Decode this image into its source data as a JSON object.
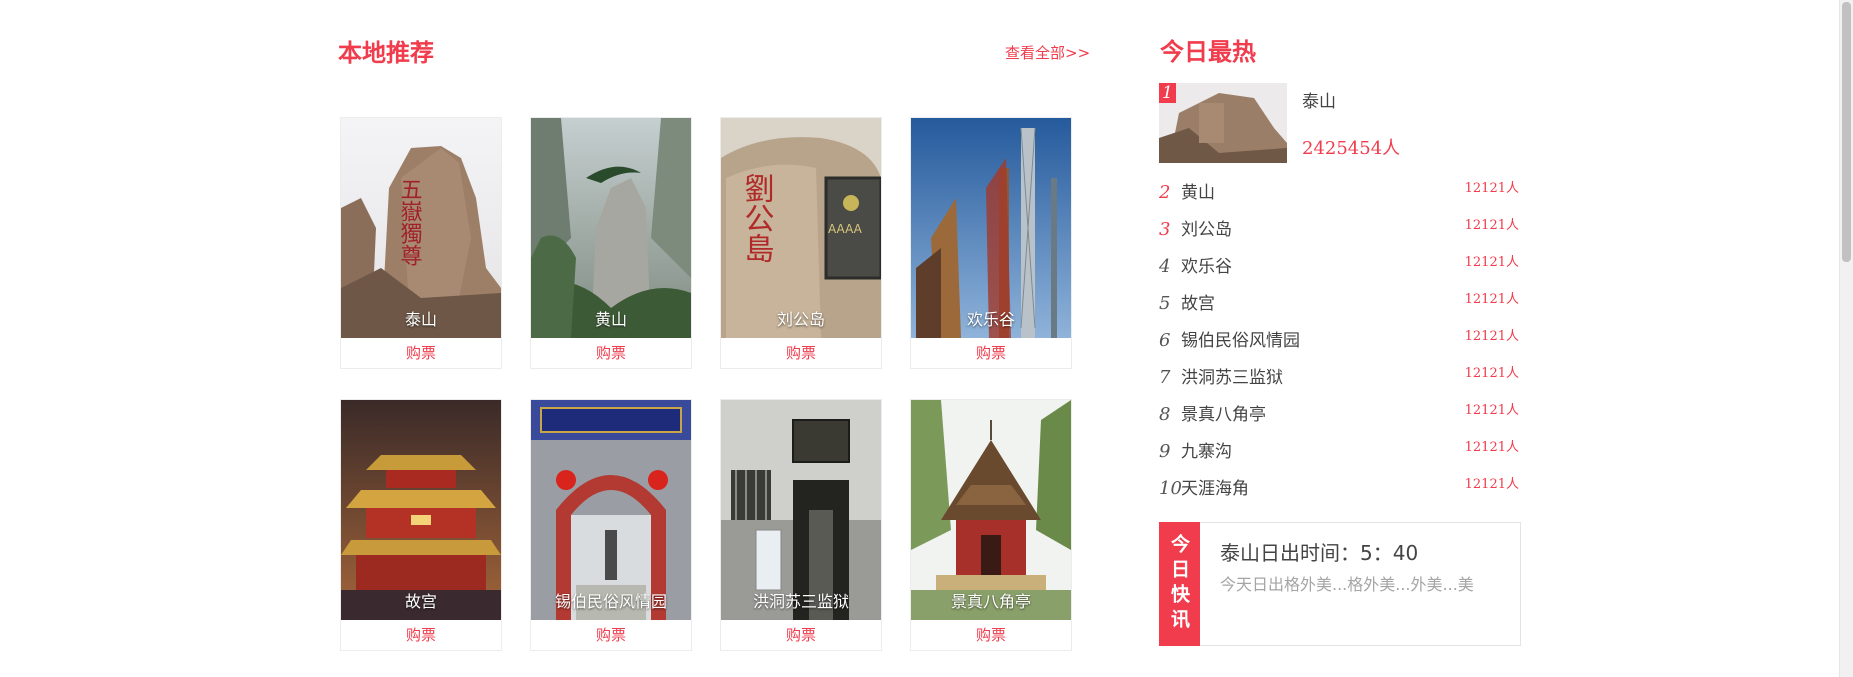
{
  "local": {
    "title": "本地推荐",
    "see_all": "查看全部>>",
    "cards": [
      {
        "name": "泰山",
        "buy": "购票",
        "image": "taishan-rock-inscription",
        "image_text": "五嶽獨尊"
      },
      {
        "name": "黄山",
        "buy": "购票",
        "image": "huangshan-pine-peak"
      },
      {
        "name": "刘公岛",
        "buy": "购票",
        "image": "liugongdao-stone",
        "image_text": "劉公島"
      },
      {
        "name": "欢乐谷",
        "buy": "购票",
        "image": "happy-valley-towers"
      },
      {
        "name": "故宫",
        "buy": "购票",
        "image": "forbidden-city-night"
      },
      {
        "name": "锡伯民俗风情园",
        "buy": "购票",
        "image": "xibo-gate"
      },
      {
        "name": "洪洞苏三监狱",
        "buy": "购票",
        "image": "sansan-prison-door"
      },
      {
        "name": "景真八角亭",
        "buy": "购票",
        "image": "jingzhen-octagonal-pavilion"
      }
    ]
  },
  "hot": {
    "title": "今日最热",
    "top": {
      "rank": "1",
      "name": "泰山",
      "count": "2425454人"
    },
    "items": [
      {
        "rank": "2",
        "name": "黄山",
        "count": "12121人"
      },
      {
        "rank": "3",
        "name": "刘公岛",
        "count": "12121人"
      },
      {
        "rank": "4",
        "name": "欢乐谷",
        "count": "12121人"
      },
      {
        "rank": "5",
        "name": "故宫",
        "count": "12121人"
      },
      {
        "rank": "6",
        "name": "锡伯民俗风情园",
        "count": "12121人"
      },
      {
        "rank": "7",
        "name": "洪洞苏三监狱",
        "count": "12121人"
      },
      {
        "rank": "8",
        "name": "景真八角亭",
        "count": "12121人"
      },
      {
        "rank": "9",
        "name": "九寨沟",
        "count": "12121人"
      },
      {
        "rank": "10",
        "name": "天涯海角",
        "count": "12121人"
      }
    ]
  },
  "news": {
    "label": "今日快讯",
    "title": "泰山日出时间：5：40",
    "desc": "今天日出格外美...格外美...外美...美"
  },
  "colors": {
    "accent": "#f03c4c",
    "text": "#444444",
    "muted": "#a5a5a5"
  }
}
